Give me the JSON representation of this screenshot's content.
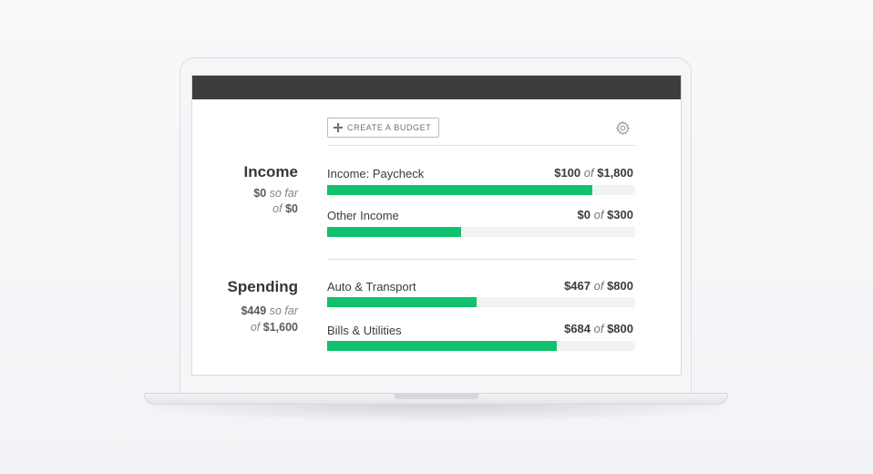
{
  "toolbar": {
    "create_budget_label": "CREATE A BUDGET",
    "plus_icon": "plus-icon",
    "settings_icon": "gear-icon"
  },
  "income": {
    "title": "Income",
    "so_far_amount": "$0",
    "so_far_text": "so far",
    "of_text": "of",
    "total_amount": "$0",
    "budgets": [
      {
        "label": "Income: Paycheck",
        "spent": "$100",
        "of": "of",
        "limit": "$1,800",
        "progress": 0.86
      },
      {
        "label": "Other Income",
        "spent": "$0",
        "of": "of",
        "limit": "$300",
        "progress": 0.435
      }
    ]
  },
  "spending": {
    "title": "Spending",
    "so_far_amount": "$449",
    "so_far_text": "so far",
    "of_text": "of",
    "total_amount": "$1,600",
    "budgets": [
      {
        "label": "Auto & Transport",
        "spent": "$467",
        "of": "of",
        "limit": "$800",
        "progress": 0.485
      },
      {
        "label": "Bills & Utilities",
        "spent": "$684",
        "of": "of",
        "limit": "$800",
        "progress": 0.745
      }
    ]
  },
  "colors": {
    "progress_fill": "#12c16f",
    "progress_track": "#f1f2f4",
    "topbar": "#3c3d3f"
  }
}
